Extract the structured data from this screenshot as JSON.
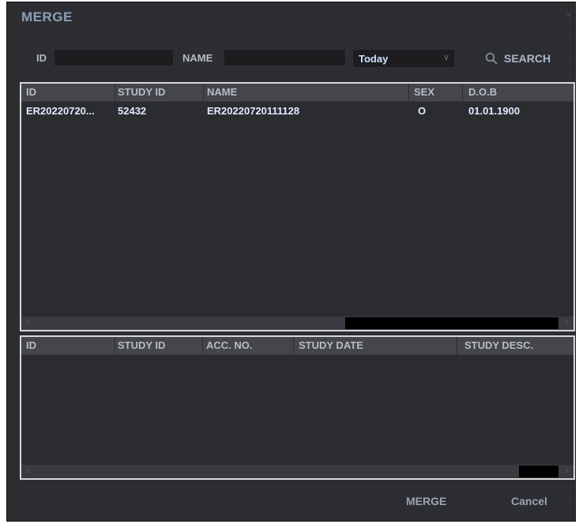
{
  "window": {
    "title": "MERGE",
    "close_glyph": "×"
  },
  "search": {
    "id_label": "ID",
    "id_value": "",
    "name_label": "NAME",
    "name_value": "",
    "date_filter": "Today",
    "search_label": "SEARCH"
  },
  "patients": {
    "columns": [
      "ID",
      "STUDY ID",
      "NAME",
      "SEX",
      "D.O.B"
    ],
    "rows": [
      {
        "id": "ER20220720...",
        "study_id": "52432",
        "name": "ER20220720111128",
        "sex": "O",
        "dob": "01.01.1900"
      }
    ]
  },
  "studies": {
    "columns": [
      "ID",
      "STUDY ID",
      "ACC. NO.",
      "STUDY DATE",
      "STUDY DESC."
    ],
    "rows": []
  },
  "footer": {
    "merge_label": "MERGE",
    "cancel_label": "Cancel"
  },
  "icons": {
    "search": "search-icon",
    "dropdown": "chevron-down-icon",
    "scroll_left": "chevron-left-icon",
    "scroll_right": "chevron-right-icon",
    "close": "close-icon"
  },
  "colors": {
    "background": "#2c2d31",
    "title": "#8d9fb8",
    "header_bg": "#44464c",
    "row_text": "#dfeaff",
    "panel_border": "#d8d8d8"
  }
}
